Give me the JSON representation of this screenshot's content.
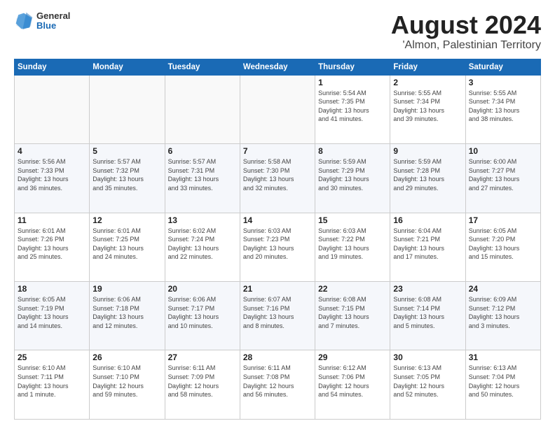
{
  "header": {
    "logo_general": "General",
    "logo_blue": "Blue",
    "title": "August 2024",
    "subtitle": "'Almon, Palestinian Territory"
  },
  "days_of_week": [
    "Sunday",
    "Monday",
    "Tuesday",
    "Wednesday",
    "Thursday",
    "Friday",
    "Saturday"
  ],
  "weeks": [
    {
      "alt": false,
      "days": [
        {
          "num": "",
          "info": ""
        },
        {
          "num": "",
          "info": ""
        },
        {
          "num": "",
          "info": ""
        },
        {
          "num": "",
          "info": ""
        },
        {
          "num": "1",
          "info": "Sunrise: 5:54 AM\nSunset: 7:35 PM\nDaylight: 13 hours\nand 41 minutes."
        },
        {
          "num": "2",
          "info": "Sunrise: 5:55 AM\nSunset: 7:34 PM\nDaylight: 13 hours\nand 39 minutes."
        },
        {
          "num": "3",
          "info": "Sunrise: 5:55 AM\nSunset: 7:34 PM\nDaylight: 13 hours\nand 38 minutes."
        }
      ]
    },
    {
      "alt": true,
      "days": [
        {
          "num": "4",
          "info": "Sunrise: 5:56 AM\nSunset: 7:33 PM\nDaylight: 13 hours\nand 36 minutes."
        },
        {
          "num": "5",
          "info": "Sunrise: 5:57 AM\nSunset: 7:32 PM\nDaylight: 13 hours\nand 35 minutes."
        },
        {
          "num": "6",
          "info": "Sunrise: 5:57 AM\nSunset: 7:31 PM\nDaylight: 13 hours\nand 33 minutes."
        },
        {
          "num": "7",
          "info": "Sunrise: 5:58 AM\nSunset: 7:30 PM\nDaylight: 13 hours\nand 32 minutes."
        },
        {
          "num": "8",
          "info": "Sunrise: 5:59 AM\nSunset: 7:29 PM\nDaylight: 13 hours\nand 30 minutes."
        },
        {
          "num": "9",
          "info": "Sunrise: 5:59 AM\nSunset: 7:28 PM\nDaylight: 13 hours\nand 29 minutes."
        },
        {
          "num": "10",
          "info": "Sunrise: 6:00 AM\nSunset: 7:27 PM\nDaylight: 13 hours\nand 27 minutes."
        }
      ]
    },
    {
      "alt": false,
      "days": [
        {
          "num": "11",
          "info": "Sunrise: 6:01 AM\nSunset: 7:26 PM\nDaylight: 13 hours\nand 25 minutes."
        },
        {
          "num": "12",
          "info": "Sunrise: 6:01 AM\nSunset: 7:25 PM\nDaylight: 13 hours\nand 24 minutes."
        },
        {
          "num": "13",
          "info": "Sunrise: 6:02 AM\nSunset: 7:24 PM\nDaylight: 13 hours\nand 22 minutes."
        },
        {
          "num": "14",
          "info": "Sunrise: 6:03 AM\nSunset: 7:23 PM\nDaylight: 13 hours\nand 20 minutes."
        },
        {
          "num": "15",
          "info": "Sunrise: 6:03 AM\nSunset: 7:22 PM\nDaylight: 13 hours\nand 19 minutes."
        },
        {
          "num": "16",
          "info": "Sunrise: 6:04 AM\nSunset: 7:21 PM\nDaylight: 13 hours\nand 17 minutes."
        },
        {
          "num": "17",
          "info": "Sunrise: 6:05 AM\nSunset: 7:20 PM\nDaylight: 13 hours\nand 15 minutes."
        }
      ]
    },
    {
      "alt": true,
      "days": [
        {
          "num": "18",
          "info": "Sunrise: 6:05 AM\nSunset: 7:19 PM\nDaylight: 13 hours\nand 14 minutes."
        },
        {
          "num": "19",
          "info": "Sunrise: 6:06 AM\nSunset: 7:18 PM\nDaylight: 13 hours\nand 12 minutes."
        },
        {
          "num": "20",
          "info": "Sunrise: 6:06 AM\nSunset: 7:17 PM\nDaylight: 13 hours\nand 10 minutes."
        },
        {
          "num": "21",
          "info": "Sunrise: 6:07 AM\nSunset: 7:16 PM\nDaylight: 13 hours\nand 8 minutes."
        },
        {
          "num": "22",
          "info": "Sunrise: 6:08 AM\nSunset: 7:15 PM\nDaylight: 13 hours\nand 7 minutes."
        },
        {
          "num": "23",
          "info": "Sunrise: 6:08 AM\nSunset: 7:14 PM\nDaylight: 13 hours\nand 5 minutes."
        },
        {
          "num": "24",
          "info": "Sunrise: 6:09 AM\nSunset: 7:12 PM\nDaylight: 13 hours\nand 3 minutes."
        }
      ]
    },
    {
      "alt": false,
      "days": [
        {
          "num": "25",
          "info": "Sunrise: 6:10 AM\nSunset: 7:11 PM\nDaylight: 13 hours\nand 1 minute."
        },
        {
          "num": "26",
          "info": "Sunrise: 6:10 AM\nSunset: 7:10 PM\nDaylight: 12 hours\nand 59 minutes."
        },
        {
          "num": "27",
          "info": "Sunrise: 6:11 AM\nSunset: 7:09 PM\nDaylight: 12 hours\nand 58 minutes."
        },
        {
          "num": "28",
          "info": "Sunrise: 6:11 AM\nSunset: 7:08 PM\nDaylight: 12 hours\nand 56 minutes."
        },
        {
          "num": "29",
          "info": "Sunrise: 6:12 AM\nSunset: 7:06 PM\nDaylight: 12 hours\nand 54 minutes."
        },
        {
          "num": "30",
          "info": "Sunrise: 6:13 AM\nSunset: 7:05 PM\nDaylight: 12 hours\nand 52 minutes."
        },
        {
          "num": "31",
          "info": "Sunrise: 6:13 AM\nSunset: 7:04 PM\nDaylight: 12 hours\nand 50 minutes."
        }
      ]
    }
  ]
}
